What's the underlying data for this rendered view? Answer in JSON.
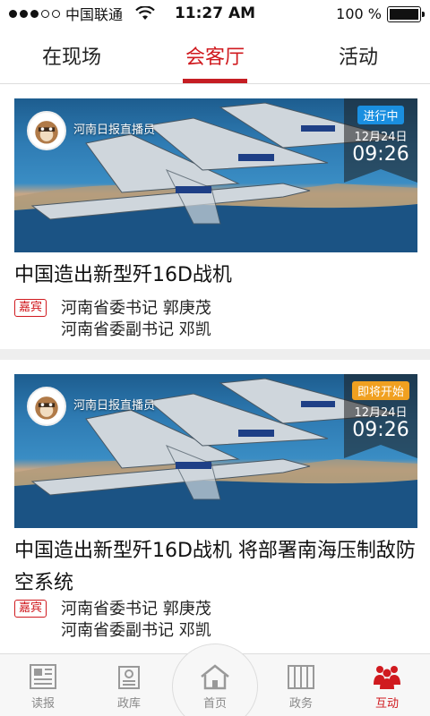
{
  "status_bar": {
    "carrier": "中国联通",
    "time": "11:27 AM",
    "battery": "100 %",
    "battery_level": 1.0,
    "signal_filled": 3,
    "signal_total": 5
  },
  "tabs": [
    {
      "label": "在现场",
      "active": false
    },
    {
      "label": "会客厅",
      "active": true
    },
    {
      "label": "活动",
      "active": false
    }
  ],
  "cards": [
    {
      "host": "河南日报直播员",
      "status": "进行中",
      "status_color": "#1a8fe0",
      "date": "12月24日",
      "time": "09:26",
      "title": "中国造出新型歼16D战机",
      "guest_tag": "嘉宾",
      "guests": [
        "河南省委书记 郭庚茂",
        "河南省委副书记 邓凯"
      ]
    },
    {
      "host": "河南日报直播员",
      "status": "即将开始",
      "status_color": "#f0a020",
      "date": "12月24日",
      "time": "09:26",
      "title": "中国造出新型歼16D战机 将部署南海压制敌防空系统",
      "guest_tag": "嘉宾",
      "guests": [
        "河南省委书记 郭庚茂",
        "河南省委副书记 邓凯"
      ]
    }
  ],
  "bottom_nav": [
    {
      "label": "读报",
      "icon": "newspaper-icon",
      "active": false
    },
    {
      "label": "政库",
      "icon": "archive-icon",
      "active": false
    },
    {
      "label": "首页",
      "icon": "home-icon",
      "active": false
    },
    {
      "label": "政务",
      "icon": "government-icon",
      "active": false
    },
    {
      "label": "互动",
      "icon": "people-icon",
      "active": true
    }
  ],
  "colors": {
    "accent": "#d01a1f",
    "nav_inactive": "#888888"
  }
}
